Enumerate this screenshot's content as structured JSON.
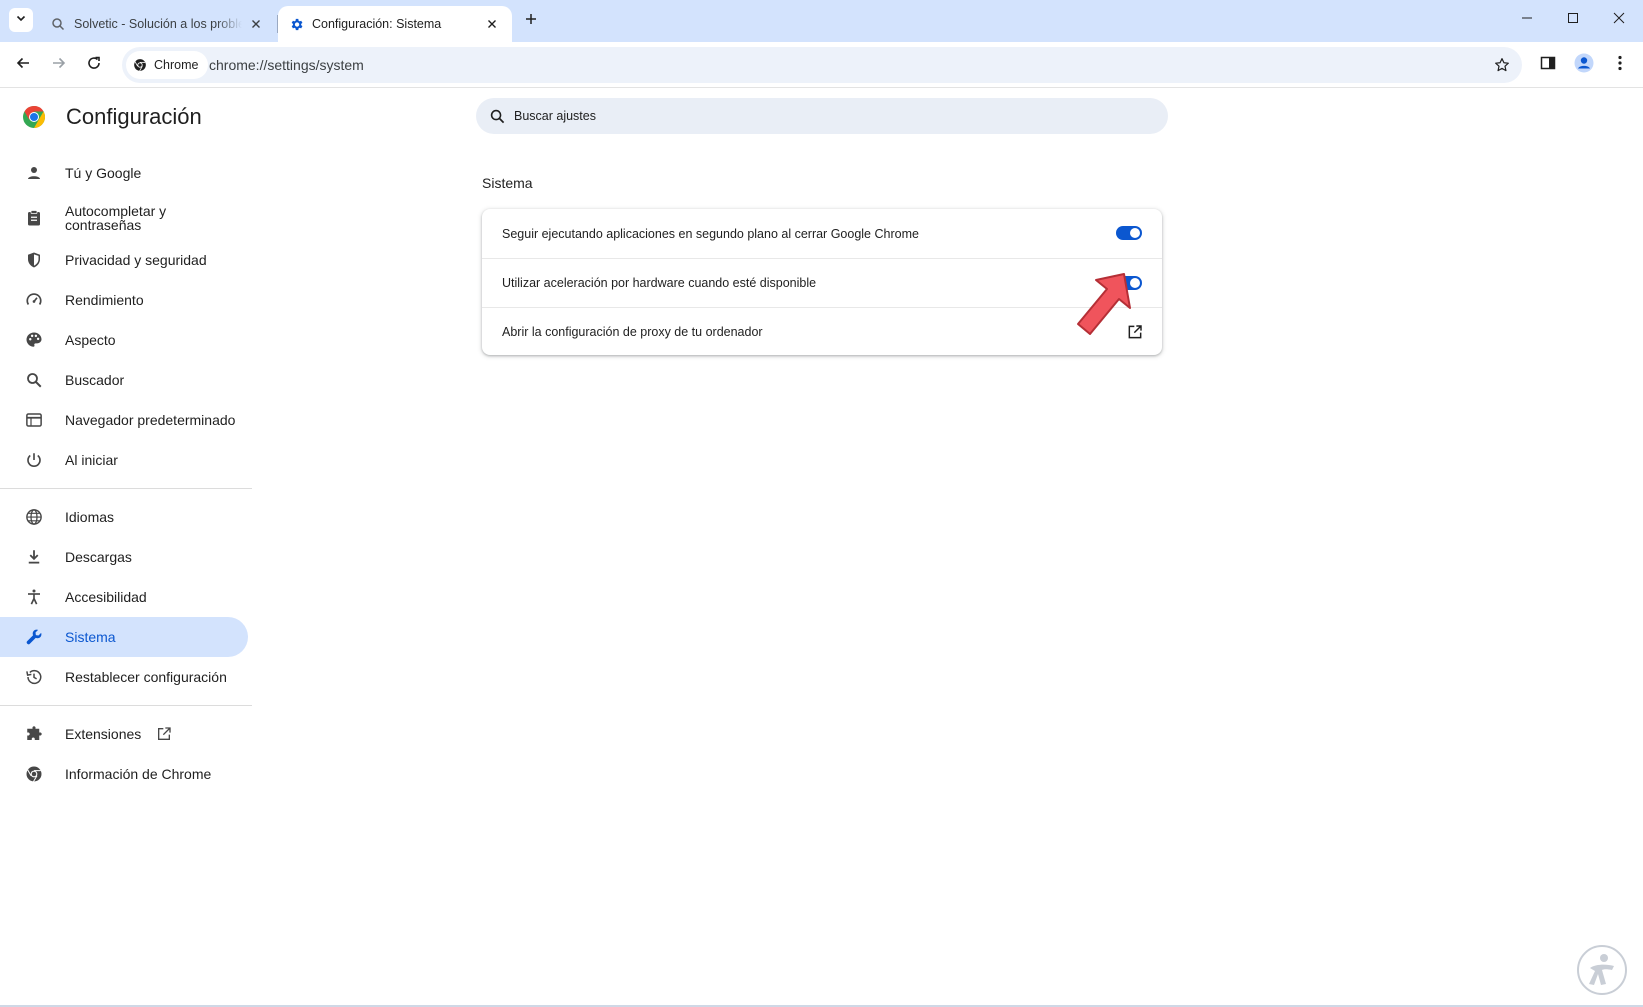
{
  "colors": {
    "tabstrip_bg": "#d3e3fd",
    "accent": "#0b57d0",
    "active_nav_bg": "#d3e3fd",
    "search_bg": "#e9eef6",
    "annotation_arrow": "#f0545c"
  },
  "tabs": [
    {
      "title": "Solvetic - Solución a los problemas",
      "icon": "search-icon",
      "active": false
    },
    {
      "title": "Configuración: Sistema",
      "icon": "gear-icon",
      "active": true
    }
  ],
  "toolbar": {
    "chip_label": "Chrome",
    "url": "chrome://settings/system"
  },
  "settings": {
    "title": "Configuración",
    "search_placeholder": "Buscar ajustes"
  },
  "sidebar": {
    "items": [
      {
        "label": "Tú y Google",
        "icon": "person-icon"
      },
      {
        "label": "Autocompletar y contraseñas",
        "icon": "clipboard-icon"
      },
      {
        "label": "Privacidad y seguridad",
        "icon": "shield-icon"
      },
      {
        "label": "Rendimiento",
        "icon": "speedometer-icon"
      },
      {
        "label": "Aspecto",
        "icon": "palette-icon"
      },
      {
        "label": "Buscador",
        "icon": "search-icon"
      },
      {
        "label": "Navegador predeterminado",
        "icon": "browser-icon"
      },
      {
        "label": "Al iniciar",
        "icon": "power-icon"
      },
      {
        "label": "Idiomas",
        "icon": "globe-icon"
      },
      {
        "label": "Descargas",
        "icon": "download-icon"
      },
      {
        "label": "Accesibilidad",
        "icon": "accessibility-icon"
      },
      {
        "label": "Sistema",
        "icon": "wrench-icon",
        "active": true
      },
      {
        "label": "Restablecer configuración",
        "icon": "history-icon"
      },
      {
        "label": "Extensiones",
        "icon": "puzzle-icon"
      },
      {
        "label": "Información de Chrome",
        "icon": "chrome-icon"
      }
    ]
  },
  "main": {
    "section_title": "Sistema",
    "rows": [
      {
        "label": "Seguir ejecutando aplicaciones en segundo plano al cerrar Google Chrome",
        "control": "toggle",
        "on": true
      },
      {
        "label": "Utilizar aceleración por hardware cuando esté disponible",
        "control": "toggle",
        "on": true
      },
      {
        "label": "Abrir la configuración de proxy de tu ordenador",
        "control": "launch-icon"
      }
    ]
  }
}
